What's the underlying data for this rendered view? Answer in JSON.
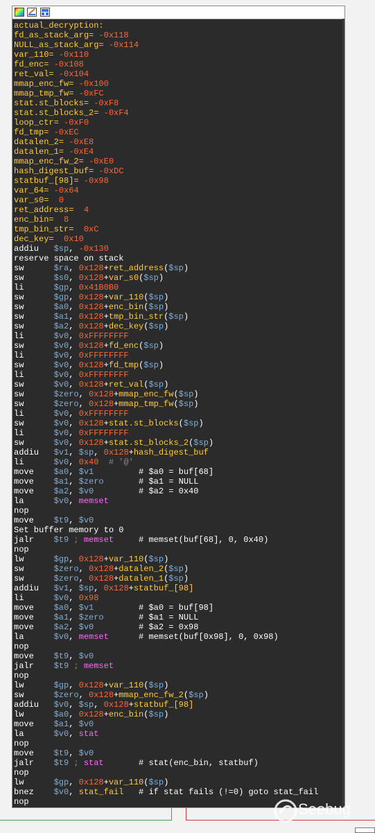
{
  "window": {
    "title": ""
  },
  "watermark": {
    "text": "Seebug"
  },
  "lines": [
    [
      [
        "lbl",
        "actual_decryption:"
      ]
    ],
    [
      [
        "lbl",
        "fd_as_stack_arg= "
      ],
      [
        "hex",
        "-0x118"
      ]
    ],
    [
      [
        "lbl",
        "NULL_as_stack_arg= "
      ],
      [
        "hex",
        "-0x114"
      ]
    ],
    [
      [
        "lbl",
        "var_110= "
      ],
      [
        "hex",
        "-0x110"
      ]
    ],
    [
      [
        "lbl",
        "fd_enc= "
      ],
      [
        "hex",
        "-0x108"
      ]
    ],
    [
      [
        "lbl",
        "ret_val= "
      ],
      [
        "hex",
        "-0x104"
      ]
    ],
    [
      [
        "lbl",
        "mmap_enc_fw= "
      ],
      [
        "hex",
        "-0x100"
      ]
    ],
    [
      [
        "lbl",
        "mmap_tmp_fw= "
      ],
      [
        "hex",
        "-0xFC"
      ]
    ],
    [
      [
        "lbl",
        "stat.st_blocks= "
      ],
      [
        "hex",
        "-0xF8"
      ]
    ],
    [
      [
        "lbl",
        "stat.st_blocks_2= "
      ],
      [
        "hex",
        "-0xF4"
      ]
    ],
    [
      [
        "lbl",
        "loop_ctr= "
      ],
      [
        "hex",
        "-0xF0"
      ]
    ],
    [
      [
        "lbl",
        "fd_tmp= "
      ],
      [
        "hex",
        "-0xEC"
      ]
    ],
    [
      [
        "lbl",
        "datalen_2= "
      ],
      [
        "hex",
        "-0xE8"
      ]
    ],
    [
      [
        "lbl",
        "datalen_1= "
      ],
      [
        "hex",
        "-0xE4"
      ]
    ],
    [
      [
        "lbl",
        "mmap_enc_fw_2= "
      ],
      [
        "hex",
        "-0xE0"
      ]
    ],
    [
      [
        "lbl",
        "hash_digest_buf= "
      ],
      [
        "hex",
        "-0xDC"
      ]
    ],
    [
      [
        "lbl",
        "statbuf_[98]= "
      ],
      [
        "hex",
        "-0x98"
      ]
    ],
    [
      [
        "lbl",
        "var_64= "
      ],
      [
        "hex",
        "-0x64"
      ]
    ],
    [
      [
        "lbl",
        "var_s0=  "
      ],
      [
        "hex",
        "0"
      ]
    ],
    [
      [
        "lbl",
        "ret_address=  "
      ],
      [
        "hex",
        "4"
      ]
    ],
    [
      [
        "lbl",
        "enc_bin=  "
      ],
      [
        "hex",
        "8"
      ]
    ],
    [
      [
        "lbl",
        "tmp_bin_str=  "
      ],
      [
        "hex",
        "0xC"
      ]
    ],
    [
      [
        "lbl",
        "dec_key=  "
      ],
      [
        "hex",
        "0x10"
      ]
    ],
    [
      [
        "ins",
        "addiu   "
      ],
      [
        "reg",
        "$sp"
      ],
      [
        "ins",
        ", "
      ],
      [
        "hex",
        "-0x130"
      ]
    ],
    [
      [
        "ins",
        "reserve space on stack"
      ]
    ],
    [
      [
        "ins",
        "sw      "
      ],
      [
        "reg",
        "$ra"
      ],
      [
        "ins",
        ", "
      ],
      [
        "hex",
        "0x128"
      ],
      [
        "ins",
        "+"
      ],
      [
        "sym",
        "ret_address"
      ],
      [
        "ins",
        "("
      ],
      [
        "reg",
        "$sp"
      ],
      [
        "ins",
        ")"
      ]
    ],
    [
      [
        "ins",
        "sw      "
      ],
      [
        "reg",
        "$s0"
      ],
      [
        "ins",
        ", "
      ],
      [
        "hex",
        "0x128"
      ],
      [
        "ins",
        "+"
      ],
      [
        "sym",
        "var_s0"
      ],
      [
        "ins",
        "("
      ],
      [
        "reg",
        "$sp"
      ],
      [
        "ins",
        ")"
      ]
    ],
    [
      [
        "ins",
        "li      "
      ],
      [
        "reg",
        "$gp"
      ],
      [
        "ins",
        ", "
      ],
      [
        "hex",
        "0x41B0B0"
      ]
    ],
    [
      [
        "ins",
        "sw      "
      ],
      [
        "reg",
        "$gp"
      ],
      [
        "ins",
        ", "
      ],
      [
        "hex",
        "0x128"
      ],
      [
        "ins",
        "+"
      ],
      [
        "sym",
        "var_110"
      ],
      [
        "ins",
        "("
      ],
      [
        "reg",
        "$sp"
      ],
      [
        "ins",
        ")"
      ]
    ],
    [
      [
        "ins",
        "sw      "
      ],
      [
        "reg",
        "$a0"
      ],
      [
        "ins",
        ", "
      ],
      [
        "hex",
        "0x128"
      ],
      [
        "ins",
        "+"
      ],
      [
        "sym",
        "enc_bin"
      ],
      [
        "ins",
        "("
      ],
      [
        "reg",
        "$sp"
      ],
      [
        "ins",
        ")"
      ]
    ],
    [
      [
        "ins",
        "sw      "
      ],
      [
        "reg",
        "$a1"
      ],
      [
        "ins",
        ", "
      ],
      [
        "hex",
        "0x128"
      ],
      [
        "ins",
        "+"
      ],
      [
        "sym",
        "tmp_bin_str"
      ],
      [
        "ins",
        "("
      ],
      [
        "reg",
        "$sp"
      ],
      [
        "ins",
        ")"
      ]
    ],
    [
      [
        "ins",
        "sw      "
      ],
      [
        "reg",
        "$a2"
      ],
      [
        "ins",
        ", "
      ],
      [
        "hex",
        "0x128"
      ],
      [
        "ins",
        "+"
      ],
      [
        "sym",
        "dec_key"
      ],
      [
        "ins",
        "("
      ],
      [
        "reg",
        "$sp"
      ],
      [
        "ins",
        ")"
      ]
    ],
    [
      [
        "ins",
        "li      "
      ],
      [
        "reg",
        "$v0"
      ],
      [
        "ins",
        ", "
      ],
      [
        "hex",
        "0xFFFFFFFF"
      ]
    ],
    [
      [
        "ins",
        "sw      "
      ],
      [
        "reg",
        "$v0"
      ],
      [
        "ins",
        ", "
      ],
      [
        "hex",
        "0x128"
      ],
      [
        "ins",
        "+"
      ],
      [
        "sym",
        "fd_enc"
      ],
      [
        "ins",
        "("
      ],
      [
        "reg",
        "$sp"
      ],
      [
        "ins",
        ")"
      ]
    ],
    [
      [
        "ins",
        "li      "
      ],
      [
        "reg",
        "$v0"
      ],
      [
        "ins",
        ", "
      ],
      [
        "hex",
        "0xFFFFFFFF"
      ]
    ],
    [
      [
        "ins",
        "sw      "
      ],
      [
        "reg",
        "$v0"
      ],
      [
        "ins",
        ", "
      ],
      [
        "hex",
        "0x128"
      ],
      [
        "ins",
        "+"
      ],
      [
        "sym",
        "fd_tmp"
      ],
      [
        "ins",
        "("
      ],
      [
        "reg",
        "$sp"
      ],
      [
        "ins",
        ")"
      ]
    ],
    [
      [
        "ins",
        "li      "
      ],
      [
        "reg",
        "$v0"
      ],
      [
        "ins",
        ", "
      ],
      [
        "hex",
        "0xFFFFFFFF"
      ]
    ],
    [
      [
        "ins",
        "sw      "
      ],
      [
        "reg",
        "$v0"
      ],
      [
        "ins",
        ", "
      ],
      [
        "hex",
        "0x128"
      ],
      [
        "ins",
        "+"
      ],
      [
        "sym",
        "ret_val"
      ],
      [
        "ins",
        "("
      ],
      [
        "reg",
        "$sp"
      ],
      [
        "ins",
        ")"
      ]
    ],
    [
      [
        "ins",
        "sw      "
      ],
      [
        "reg",
        "$zero"
      ],
      [
        "ins",
        ", "
      ],
      [
        "hex",
        "0x128"
      ],
      [
        "ins",
        "+"
      ],
      [
        "sym",
        "mmap_enc_fw"
      ],
      [
        "ins",
        "("
      ],
      [
        "reg",
        "$sp"
      ],
      [
        "ins",
        ")"
      ]
    ],
    [
      [
        "ins",
        "sw      "
      ],
      [
        "reg",
        "$zero"
      ],
      [
        "ins",
        ", "
      ],
      [
        "hex",
        "0x128"
      ],
      [
        "ins",
        "+"
      ],
      [
        "sym",
        "mmap_tmp_fw"
      ],
      [
        "ins",
        "("
      ],
      [
        "reg",
        "$sp"
      ],
      [
        "ins",
        ")"
      ]
    ],
    [
      [
        "ins",
        "li      "
      ],
      [
        "reg",
        "$v0"
      ],
      [
        "ins",
        ", "
      ],
      [
        "hex",
        "0xFFFFFFFF"
      ]
    ],
    [
      [
        "ins",
        "sw      "
      ],
      [
        "reg",
        "$v0"
      ],
      [
        "ins",
        ", "
      ],
      [
        "hex",
        "0x128"
      ],
      [
        "ins",
        "+"
      ],
      [
        "sym",
        "stat.st_blocks"
      ],
      [
        "ins",
        "("
      ],
      [
        "reg",
        "$sp"
      ],
      [
        "ins",
        ")"
      ]
    ],
    [
      [
        "ins",
        "li      "
      ],
      [
        "reg",
        "$v0"
      ],
      [
        "ins",
        ", "
      ],
      [
        "hex",
        "0xFFFFFFFF"
      ]
    ],
    [
      [
        "ins",
        "sw      "
      ],
      [
        "reg",
        "$v0"
      ],
      [
        "ins",
        ", "
      ],
      [
        "hex",
        "0x128"
      ],
      [
        "ins",
        "+"
      ],
      [
        "sym",
        "stat.st_blocks_2"
      ],
      [
        "ins",
        "("
      ],
      [
        "reg",
        "$sp"
      ],
      [
        "ins",
        ")"
      ]
    ],
    [
      [
        "ins",
        "addiu   "
      ],
      [
        "reg",
        "$v1"
      ],
      [
        "ins",
        ", "
      ],
      [
        "reg",
        "$sp"
      ],
      [
        "ins",
        ", "
      ],
      [
        "hex",
        "0x128"
      ],
      [
        "ins",
        "+"
      ],
      [
        "sym",
        "hash_digest_buf"
      ]
    ],
    [
      [
        "ins",
        "li      "
      ],
      [
        "reg",
        "$v0"
      ],
      [
        "ins",
        ", "
      ],
      [
        "hex",
        "0x40"
      ],
      [
        "gry",
        "  # '@'"
      ]
    ],
    [
      [
        "ins",
        "move    "
      ],
      [
        "reg",
        "$a0"
      ],
      [
        "ins",
        ", "
      ],
      [
        "reg",
        "$v1"
      ],
      [
        "cmt",
        "         # $a0 = buf[68]"
      ]
    ],
    [
      [
        "ins",
        "move    "
      ],
      [
        "reg",
        "$a1"
      ],
      [
        "ins",
        ", "
      ],
      [
        "reg",
        "$zero"
      ],
      [
        "cmt",
        "       # $a1 = NULL"
      ]
    ],
    [
      [
        "ins",
        "move    "
      ],
      [
        "reg",
        "$a2"
      ],
      [
        "ins",
        ", "
      ],
      [
        "reg",
        "$v0"
      ],
      [
        "cmt",
        "         # $a2 = 0x40"
      ]
    ],
    [
      [
        "ins",
        "la      "
      ],
      [
        "reg",
        "$v0"
      ],
      [
        "ins",
        ", "
      ],
      [
        "fn",
        "memset"
      ]
    ],
    [
      [
        "ins",
        "nop"
      ]
    ],
    [
      [
        "ins",
        "move    "
      ],
      [
        "reg",
        "$t9"
      ],
      [
        "ins",
        ", "
      ],
      [
        "reg",
        "$v0"
      ]
    ],
    [
      [
        "ins",
        "Set buffer memory to 0"
      ]
    ],
    [
      [
        "ins",
        "jalr    "
      ],
      [
        "reg",
        "$t9"
      ],
      [
        "gry",
        " ; "
      ],
      [
        "fn",
        "memset"
      ],
      [
        "cmt",
        "     # memset(buf[68], 0, 0x40)"
      ]
    ],
    [
      [
        "ins",
        "nop"
      ]
    ],
    [
      [
        "ins",
        "lw      "
      ],
      [
        "reg",
        "$gp"
      ],
      [
        "ins",
        ", "
      ],
      [
        "hex",
        "0x128"
      ],
      [
        "ins",
        "+"
      ],
      [
        "sym",
        "var_110"
      ],
      [
        "ins",
        "("
      ],
      [
        "reg",
        "$sp"
      ],
      [
        "ins",
        ")"
      ]
    ],
    [
      [
        "ins",
        "sw      "
      ],
      [
        "reg",
        "$zero"
      ],
      [
        "ins",
        ", "
      ],
      [
        "hex",
        "0x128"
      ],
      [
        "ins",
        "+"
      ],
      [
        "sym",
        "datalen_2"
      ],
      [
        "ins",
        "("
      ],
      [
        "reg",
        "$sp"
      ],
      [
        "ins",
        ")"
      ]
    ],
    [
      [
        "ins",
        "sw      "
      ],
      [
        "reg",
        "$zero"
      ],
      [
        "ins",
        ", "
      ],
      [
        "hex",
        "0x128"
      ],
      [
        "ins",
        "+"
      ],
      [
        "sym",
        "datalen_1"
      ],
      [
        "ins",
        "("
      ],
      [
        "reg",
        "$sp"
      ],
      [
        "ins",
        ")"
      ]
    ],
    [
      [
        "ins",
        "addiu   "
      ],
      [
        "reg",
        "$v1"
      ],
      [
        "ins",
        ", "
      ],
      [
        "reg",
        "$sp"
      ],
      [
        "ins",
        ", "
      ],
      [
        "hex",
        "0x128"
      ],
      [
        "ins",
        "+"
      ],
      [
        "sym",
        "statbuf_[98]"
      ]
    ],
    [
      [
        "ins",
        "li      "
      ],
      [
        "reg",
        "$v0"
      ],
      [
        "ins",
        ", "
      ],
      [
        "hex",
        "0x98"
      ]
    ],
    [
      [
        "ins",
        "move    "
      ],
      [
        "reg",
        "$a0"
      ],
      [
        "ins",
        ", "
      ],
      [
        "reg",
        "$v1"
      ],
      [
        "cmt",
        "         # $a0 = buf[98]"
      ]
    ],
    [
      [
        "ins",
        "move    "
      ],
      [
        "reg",
        "$a1"
      ],
      [
        "ins",
        ", "
      ],
      [
        "reg",
        "$zero"
      ],
      [
        "cmt",
        "       # $a1 = NULL"
      ]
    ],
    [
      [
        "ins",
        "move    "
      ],
      [
        "reg",
        "$a2"
      ],
      [
        "ins",
        ", "
      ],
      [
        "reg",
        "$v0"
      ],
      [
        "cmt",
        "         # $a2 = 0x98"
      ]
    ],
    [
      [
        "ins",
        "la      "
      ],
      [
        "reg",
        "$v0"
      ],
      [
        "ins",
        ", "
      ],
      [
        "fn",
        "memset"
      ],
      [
        "cmt",
        "      # memset(buf[0x98], 0, 0x98)"
      ]
    ],
    [
      [
        "ins",
        "nop"
      ]
    ],
    [
      [
        "ins",
        "move    "
      ],
      [
        "reg",
        "$t9"
      ],
      [
        "ins",
        ", "
      ],
      [
        "reg",
        "$v0"
      ]
    ],
    [
      [
        "ins",
        "jalr    "
      ],
      [
        "reg",
        "$t9"
      ],
      [
        "gry",
        " ; "
      ],
      [
        "fn",
        "memset"
      ]
    ],
    [
      [
        "ins",
        "nop"
      ]
    ],
    [
      [
        "ins",
        "lw      "
      ],
      [
        "reg",
        "$gp"
      ],
      [
        "ins",
        ", "
      ],
      [
        "hex",
        "0x128"
      ],
      [
        "ins",
        "+"
      ],
      [
        "sym",
        "var_110"
      ],
      [
        "ins",
        "("
      ],
      [
        "reg",
        "$sp"
      ],
      [
        "ins",
        ")"
      ]
    ],
    [
      [
        "ins",
        "sw      "
      ],
      [
        "reg",
        "$zero"
      ],
      [
        "ins",
        ", "
      ],
      [
        "hex",
        "0x128"
      ],
      [
        "ins",
        "+"
      ],
      [
        "sym",
        "mmap_enc_fw_2"
      ],
      [
        "ins",
        "("
      ],
      [
        "reg",
        "$sp"
      ],
      [
        "ins",
        ")"
      ]
    ],
    [
      [
        "ins",
        "addiu   "
      ],
      [
        "reg",
        "$v0"
      ],
      [
        "ins",
        ", "
      ],
      [
        "reg",
        "$sp"
      ],
      [
        "ins",
        ", "
      ],
      [
        "hex",
        "0x128"
      ],
      [
        "ins",
        "+"
      ],
      [
        "sym",
        "statbuf_[98]"
      ]
    ],
    [
      [
        "ins",
        "lw      "
      ],
      [
        "reg",
        "$a0"
      ],
      [
        "ins",
        ", "
      ],
      [
        "hex",
        "0x128"
      ],
      [
        "ins",
        "+"
      ],
      [
        "sym",
        "enc_bin"
      ],
      [
        "ins",
        "("
      ],
      [
        "reg",
        "$sp"
      ],
      [
        "ins",
        ")"
      ]
    ],
    [
      [
        "ins",
        "move    "
      ],
      [
        "reg",
        "$a1"
      ],
      [
        "ins",
        ", "
      ],
      [
        "reg",
        "$v0"
      ]
    ],
    [
      [
        "ins",
        "la      "
      ],
      [
        "reg",
        "$v0"
      ],
      [
        "ins",
        ", "
      ],
      [
        "fn",
        "stat"
      ]
    ],
    [
      [
        "ins",
        "nop"
      ]
    ],
    [
      [
        "ins",
        "move    "
      ],
      [
        "reg",
        "$t9"
      ],
      [
        "ins",
        ", "
      ],
      [
        "reg",
        "$v0"
      ]
    ],
    [
      [
        "ins",
        "jalr    "
      ],
      [
        "reg",
        "$t9"
      ],
      [
        "gry",
        " ; "
      ],
      [
        "fn",
        "stat"
      ],
      [
        "cmt",
        "       # stat(enc_bin, statbuf)"
      ]
    ],
    [
      [
        "ins",
        "nop"
      ]
    ],
    [
      [
        "ins",
        "lw      "
      ],
      [
        "reg",
        "$gp"
      ],
      [
        "ins",
        ", "
      ],
      [
        "hex",
        "0x128"
      ],
      [
        "ins",
        "+"
      ],
      [
        "sym",
        "var_110"
      ],
      [
        "ins",
        "("
      ],
      [
        "reg",
        "$sp"
      ],
      [
        "ins",
        ")"
      ]
    ],
    [
      [
        "ins",
        "bnez    "
      ],
      [
        "reg",
        "$v0"
      ],
      [
        "ins",
        ", "
      ],
      [
        "sym",
        "stat_fail"
      ],
      [
        "cmt",
        "   # if stat fails (!=0) goto stat_fail"
      ]
    ],
    [
      [
        "ins",
        "nop"
      ]
    ]
  ]
}
